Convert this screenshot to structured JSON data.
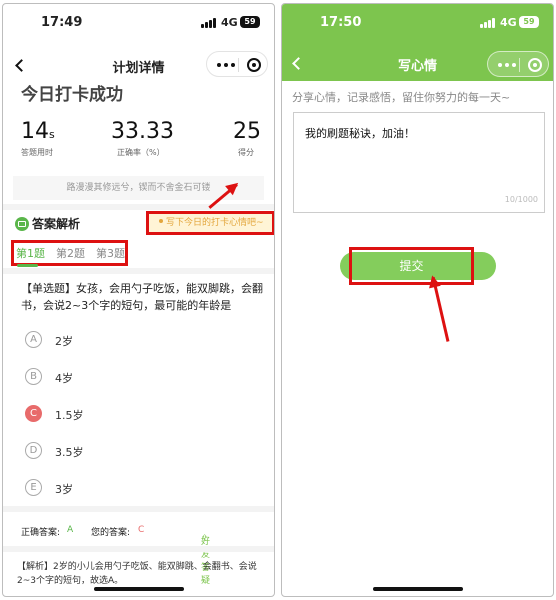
{
  "colors": {
    "accent_green": "#7dc54e",
    "annotation_red": "#dd1111",
    "hint_orange": "#e3a63c",
    "wrong_red": "#e86b6b"
  },
  "phone1": {
    "status": {
      "time": "17:49",
      "network": "4G",
      "battery": "59"
    },
    "nav": {
      "title": "计划详情",
      "back_icon": "chevron-left-icon",
      "more_icon": "more-dots-icon",
      "target_icon": "target-icon"
    },
    "success_title": "今日打卡成功",
    "stats": [
      {
        "value": "14",
        "unit": "s",
        "label": "答题用时"
      },
      {
        "value": "33.33",
        "unit": "",
        "label": "正确率（%）"
      },
      {
        "value": "25",
        "unit": "",
        "label": "得分"
      }
    ],
    "motto": "路漫漫其修远兮，锲而不舍金石可镂",
    "answers": {
      "title": "答案解析",
      "mood_hint": "写下今日的打卡心情吧~",
      "tabs": [
        "第1题",
        "第2题",
        "第3题"
      ],
      "question": "【单选题】女孩，会用勺子吃饭，能双脚跳，会翻书，会说2~3个字的短句，最可能的年龄是",
      "options": [
        {
          "letter": "A",
          "text": "2岁"
        },
        {
          "letter": "B",
          "text": "4岁"
        },
        {
          "letter": "C",
          "text": "1.5岁"
        },
        {
          "letter": "D",
          "text": "3.5岁"
        },
        {
          "letter": "E",
          "text": "3岁"
        }
      ],
      "correct_label": "正确答案:",
      "correct_value": "A",
      "your_label": "您的答案:",
      "your_value": "C",
      "friend_label": "好友答疑",
      "explanation": "【解析】2岁的小儿会用勺子吃饭、能双脚跳、会翻书、会说2~3个字的短句，故选A。"
    }
  },
  "phone2": {
    "status": {
      "time": "17:50",
      "network": "4G",
      "battery": "59"
    },
    "nav": {
      "title": "写心情"
    },
    "share_prompt": "分享心情，记录感悟，留住你努力的每一天~",
    "input": {
      "value": "我的刷题秘诀，加油！",
      "count": "10/1000"
    },
    "submit_label": "提交"
  }
}
